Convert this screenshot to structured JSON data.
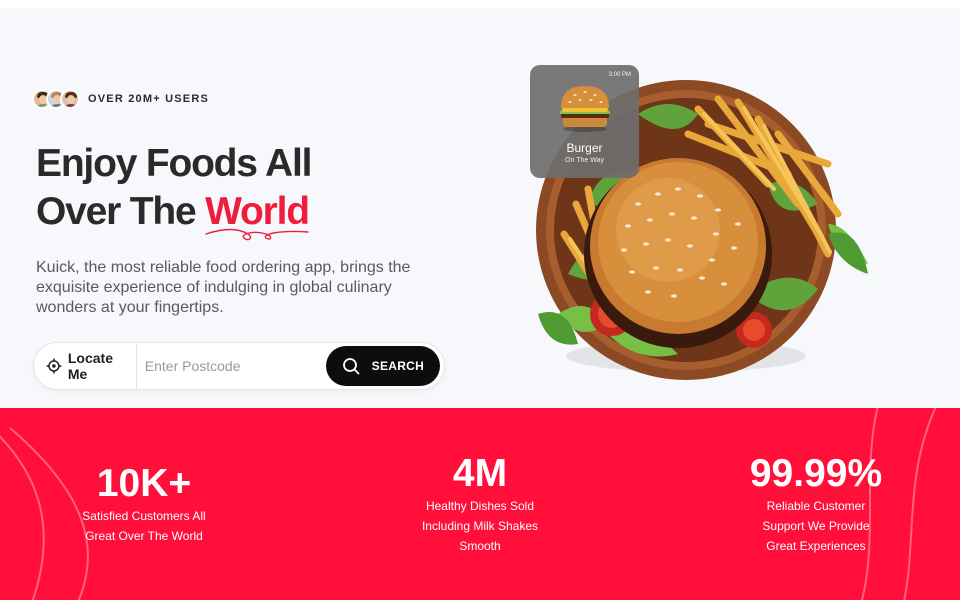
{
  "hero": {
    "users_label": "OVER 20M+ USERS",
    "headline_line1": "Enjoy Foods All",
    "headline_line2_prefix": "Over The ",
    "headline_accent": "World",
    "description": "Kuick, the most reliable food ordering app, brings the exquisite experience of indulging in global culinary wonders at your fingertips.",
    "locate_label": "Locate Me",
    "postcode_placeholder": "Enter Postcode",
    "search_label": "SEARCH"
  },
  "order_card": {
    "time": "3:00 PM",
    "item": "Burger",
    "status": "On The Way"
  },
  "stats": [
    {
      "value": "10K+",
      "caption_line1": "Satisfied Customers All",
      "caption_line2": "Great Over The World",
      "caption_line3": ""
    },
    {
      "value": "4M",
      "caption_line1": "Healthy Dishes Sold",
      "caption_line2": "Including Milk Shakes",
      "caption_line3": "Smooth"
    },
    {
      "value": "99.99%",
      "caption_line1": "Reliable Customer",
      "caption_line2": "Support We Provide",
      "caption_line3": "Great Experiences"
    }
  ],
  "colors": {
    "accent": "#ee1c3d",
    "stats_band": "#ff0f3a",
    "search_button": "#0d0d0d",
    "hero_bg": "#f7f8fb"
  },
  "icons": {
    "locate": "crosshair-icon",
    "search": "search-icon"
  }
}
